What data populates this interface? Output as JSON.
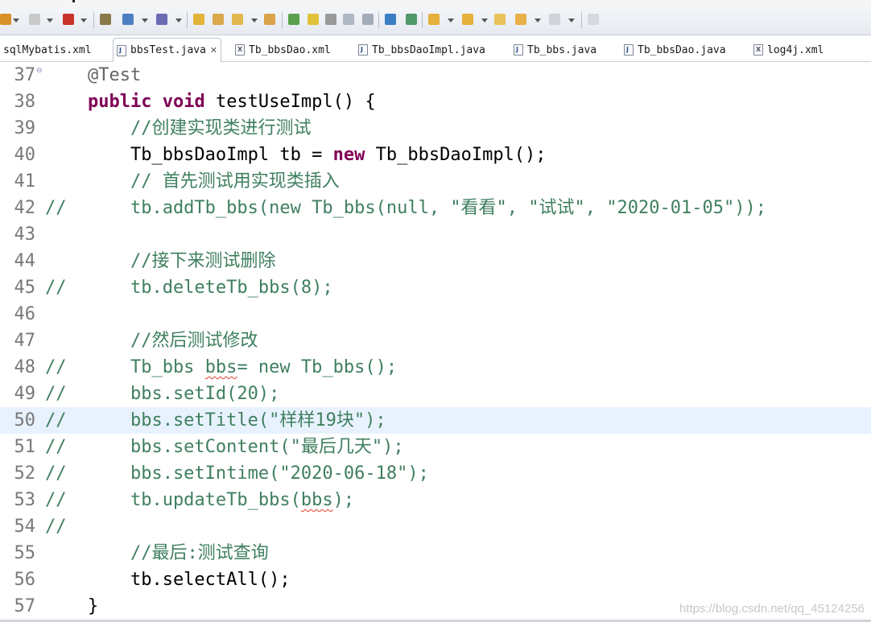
{
  "toolbar": {
    "icons": [
      "debug-icon",
      "stop-icon",
      "run-icon",
      "workspace-icon",
      "new-class-icon",
      "new-package-icon",
      "open-type-icon",
      "open-folder-icon",
      "pen-icon",
      "folder-icon",
      "pin-icon",
      "marker-icon",
      "wrench-icon",
      "window-icon",
      "panel-icon",
      "globe-icon",
      "sync-icon",
      "next-annotation-icon",
      "prev-annotation-icon",
      "back-icon",
      "back-arrow-icon",
      "forward-arrow-icon",
      "pin-editor-icon"
    ]
  },
  "tabs": [
    {
      "label": "sqlMybatis.xml",
      "type": "xml"
    },
    {
      "label": "bbsTest.java",
      "type": "java",
      "active": true,
      "close": "✕"
    },
    {
      "label": "Tb_bbsDao.xml",
      "type": "xml"
    },
    {
      "label": "Tb_bbsDaoImpl.java",
      "type": "java"
    },
    {
      "label": "Tb_bbs.java",
      "type": "java"
    },
    {
      "label": "Tb_bbsDao.java",
      "type": "java"
    },
    {
      "label": "log4j.xml",
      "type": "xml"
    }
  ],
  "editor": {
    "lines": [
      {
        "num": "37",
        "fold": "⊖",
        "tokens": [
          {
            "t": "    "
          },
          {
            "t": "@Test",
            "c": "ann"
          }
        ]
      },
      {
        "num": "38",
        "tokens": [
          {
            "t": "    "
          },
          {
            "t": "public",
            "c": "kw"
          },
          {
            "t": " "
          },
          {
            "t": "void",
            "c": "kw"
          },
          {
            "t": " testUseImpl() {"
          }
        ]
      },
      {
        "num": "39",
        "tokens": [
          {
            "t": "        "
          },
          {
            "t": "//创建实现类进行测试",
            "c": "comment"
          }
        ]
      },
      {
        "num": "40",
        "tokens": [
          {
            "t": "        Tb_bbsDaoImpl tb = "
          },
          {
            "t": "new",
            "c": "kw"
          },
          {
            "t": " Tb_bbsDaoImpl();"
          }
        ]
      },
      {
        "num": "41",
        "tokens": [
          {
            "t": "        "
          },
          {
            "t": "// 首先测试用实现类插入",
            "c": "comment"
          }
        ]
      },
      {
        "num": "42",
        "tokens": [
          {
            "t": "//      tb.addTb_bbs(new Tb_bbs(null, \"看看\", \"试试\", \"2020-01-05\"));",
            "c": "comment"
          }
        ]
      },
      {
        "num": "43",
        "tokens": []
      },
      {
        "num": "44",
        "tokens": [
          {
            "t": "        "
          },
          {
            "t": "//接下来测试删除",
            "c": "comment"
          }
        ]
      },
      {
        "num": "45",
        "tokens": [
          {
            "t": "//      tb.deleteTb_bbs(8);",
            "c": "comment"
          }
        ]
      },
      {
        "num": "46",
        "tokens": []
      },
      {
        "num": "47",
        "tokens": [
          {
            "t": "        "
          },
          {
            "t": "//然后测试修改",
            "c": "comment"
          }
        ]
      },
      {
        "num": "48",
        "tokens": [
          {
            "t": "//      Tb_bbs ",
            "c": "comment"
          },
          {
            "t": "bbs",
            "c": "comment",
            "squig": true
          },
          {
            "t": "= new Tb_bbs();",
            "c": "comment"
          }
        ]
      },
      {
        "num": "49",
        "tokens": [
          {
            "t": "//      bbs.setId(20);",
            "c": "comment"
          }
        ]
      },
      {
        "num": "50",
        "current": true,
        "tokens": [
          {
            "t": "//      bbs.setTitle(\"样样19块\");",
            "c": "comment"
          }
        ]
      },
      {
        "num": "51",
        "tokens": [
          {
            "t": "//      bbs.setContent(\"最后几天\");",
            "c": "comment"
          }
        ]
      },
      {
        "num": "52",
        "tokens": [
          {
            "t": "//      bbs.setIntime(\"2020-06-18\");",
            "c": "comment"
          }
        ]
      },
      {
        "num": "53",
        "tokens": [
          {
            "t": "//      tb.updateTb_bbs(",
            "c": "comment"
          },
          {
            "t": "bbs",
            "c": "comment",
            "squig": true
          },
          {
            "t": ");",
            "c": "comment"
          }
        ]
      },
      {
        "num": "54",
        "tokens": [
          {
            "t": "//",
            "c": "comment"
          }
        ]
      },
      {
        "num": "55",
        "tokens": [
          {
            "t": "        "
          },
          {
            "t": "//最后:测试查询",
            "c": "comment"
          }
        ]
      },
      {
        "num": "56",
        "tokens": [
          {
            "t": "        tb.selectAll();"
          }
        ]
      },
      {
        "num": "57",
        "tokens": [
          {
            "t": "    }"
          }
        ]
      }
    ]
  },
  "watermark": "https://blog.csdn.net/qq_45124256"
}
